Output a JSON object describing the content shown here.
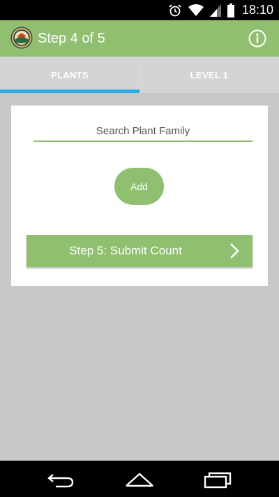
{
  "status_bar": {
    "time": "18:10",
    "icons": [
      "alarm-icon",
      "wifi-icon",
      "signal-icon",
      "battery-icon"
    ]
  },
  "app_bar": {
    "title": "Step 4 of 5",
    "logo": "app-logo-icon",
    "info": "info-icon",
    "color": "#8fbf6f"
  },
  "tabs": [
    {
      "label": "PLANTS",
      "active": true
    },
    {
      "label": "LEVEL 1",
      "active": false
    }
  ],
  "tab_indicator_color": "#2baee6",
  "form": {
    "search_placeholder": "Search Plant Family",
    "search_value": "",
    "add_label": "Add",
    "submit_label": "Step 5: Submit Count"
  },
  "nav_bar": {
    "buttons": [
      "back-icon",
      "home-icon",
      "recents-icon"
    ]
  }
}
